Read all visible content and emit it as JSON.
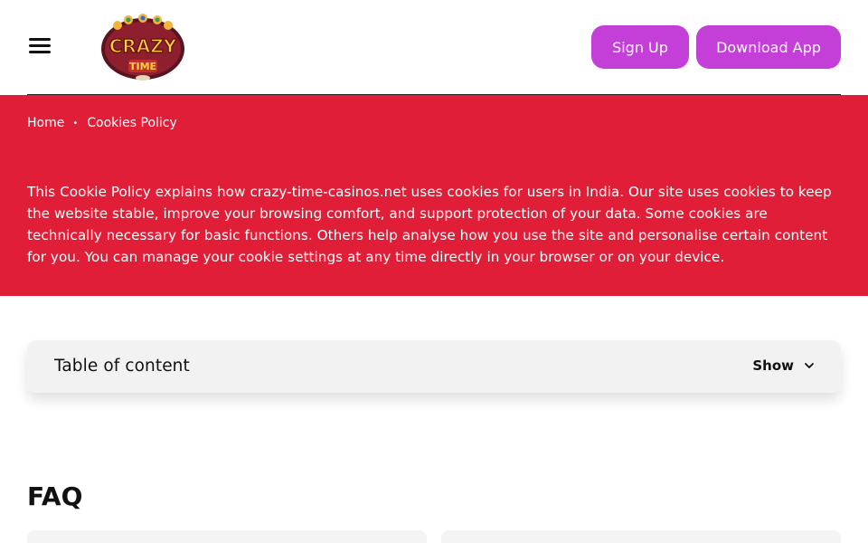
{
  "header": {
    "menu_icon": "hamburger-menu-icon",
    "logo_alt": "Crazy Time",
    "signup_label": "Sign Up",
    "download_label": "Download App",
    "accent_color": "#c33fd8"
  },
  "breadcrumb": {
    "home": "Home",
    "separator": "•",
    "current": "Cookies Policy"
  },
  "hero": {
    "background": "#e01e37",
    "text": "This Cookie Policy explains how crazy-time-casinos.net uses cookies for users in India. Our site uses cookies to keep the website stable, improve your browsing comfort, and support protection of your data. Some cookies are technically necessary for basic functions. Others help analyse how you use the site and personalise certain content for you. You can manage your cookie settings at any time directly in your browser or on your device."
  },
  "toc": {
    "title": "Table of content",
    "toggle_label": "Show",
    "toggle_icon": "chevron-down-icon"
  },
  "faq": {
    "title": "FAQ"
  }
}
